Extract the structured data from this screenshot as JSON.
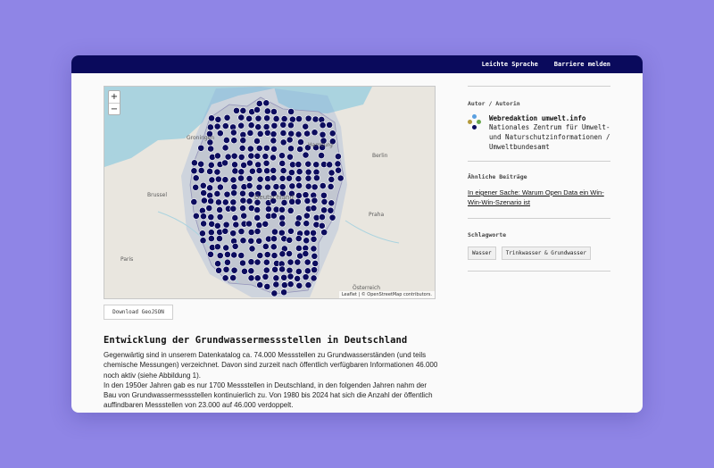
{
  "topbar": {
    "easy_language": "Leichte Sprache",
    "report_barrier": "Barriere melden"
  },
  "map": {
    "zoom_in": "+",
    "zoom_out": "−",
    "attribution": "Leaflet | © OpenStreetMap contributors.",
    "place_labels": [
      "Groningen",
      "Berlin",
      "Paris",
      "Brussel",
      "Praha",
      "Österreich",
      "Hamburg",
      "Deutschland"
    ],
    "marker_colors": {
      "marker": "#0c0c5e",
      "cluster_halo": "#7fa0d8",
      "land": "#e9e6df",
      "germany": "#d9d5cf",
      "sea": "#aad3df"
    }
  },
  "download_label": "Download GeoJSON",
  "article": {
    "title": "Entwicklung der Grundwassermessstellen in Deutschland",
    "p1": "Gegenwärtig sind in unserem Datenkatalog ca. 74.000 Messstellen zu Grundwasserständen (und teils chemische Messungen) verzeichnet. Davon sind zurzeit nach öffentlich verfügbaren Informationen 46.000 noch aktiv (siehe Abbildung 1).",
    "p2": "In den 1950er Jahren gab es nur 1700 Messstellen in Deutschland, in den folgenden Jahren nahm der Bau von Grundwassermessstellen kontinuierlich zu. Von 1980 bis 2024 hat sich die Anzahl der öffentlich auffindbaren Messstellen von 23.000 auf 46.000 verdoppelt."
  },
  "sidebar": {
    "author_heading": "Autor / Autorin",
    "author_name": "Webredaktion umwelt.info",
    "author_org": "Nationales Zentrum für Umwelt- und Naturschutzinformationen / Umweltbundesamt",
    "related_heading": "Ähnliche Beiträge",
    "related_link": "In eigener Sache: Warum Open Data ein Win-Win-Win-Szenario ist",
    "tags_heading": "Schlagworte",
    "tags": [
      "Wasser",
      "Trinkwasser & Grundwasser"
    ],
    "logo_colors": [
      "#5aa0e0",
      "#b49a3c",
      "#0c0c5e",
      "#5aa0e0",
      "#6aa84f"
    ]
  }
}
